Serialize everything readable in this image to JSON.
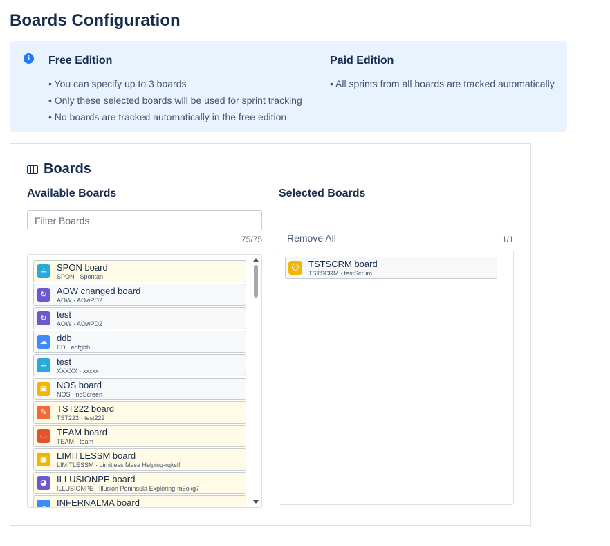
{
  "page": {
    "title": "Boards Configuration"
  },
  "info": {
    "free": {
      "title": "Free Edition",
      "items": [
        "• You can specify up to 3 boards",
        "• Only these selected boards will be used for sprint tracking",
        "• No boards are tracked automatically in the free edition"
      ]
    },
    "paid": {
      "title": "Paid Edition",
      "items": [
        "• All sprints from all boards are tracked automatically"
      ]
    }
  },
  "boards": {
    "title": "Boards",
    "available": {
      "title": "Available Boards",
      "filter_placeholder": "Filter Boards",
      "count": "75/75",
      "items": [
        {
          "name": "SPON board",
          "meta": "SPON · Spontan",
          "icon": "cup-icon",
          "color": "#2aa8d8",
          "glyph": "☕"
        },
        {
          "name": "AOW changed board",
          "meta": "AOW · AOwPD2",
          "icon": "refresh-icon",
          "color": "#6b5acd",
          "glyph": "↻"
        },
        {
          "name": "test",
          "meta": "AOW · AOwPD2",
          "icon": "refresh-icon",
          "color": "#6b5acd",
          "glyph": "↻"
        },
        {
          "name": "ddb",
          "meta": "ED · edfghb",
          "icon": "cloud-icon",
          "color": "#3d8bfd",
          "glyph": "☁"
        },
        {
          "name": "test",
          "meta": "XXXXX · xxxxx",
          "icon": "cup-icon",
          "color": "#2aa8d8",
          "glyph": "☕"
        },
        {
          "name": "NOS board",
          "meta": "NOS · noScreen",
          "icon": "wallet-icon",
          "color": "#f2b600",
          "glyph": "▣"
        },
        {
          "name": "TST222 board",
          "meta": "TST222 · test222",
          "icon": "wrench-icon",
          "color": "#f06a3b",
          "glyph": "✎"
        },
        {
          "name": "TEAM board",
          "meta": "TEAM · team",
          "icon": "window-icon",
          "color": "#e5532d",
          "glyph": "▭"
        },
        {
          "name": "LIMITLESSM board",
          "meta": "LIMITLESSM · Limitless Mesa Helping-rqkslf",
          "icon": "wallet-icon",
          "color": "#f2b600",
          "glyph": "▣"
        },
        {
          "name": "ILLUSIONPE board",
          "meta": "ILLUSIONPE · Illusion Peninsula Exploring-m5okg7",
          "icon": "bird-icon",
          "color": "#6b5acd",
          "glyph": "◕"
        },
        {
          "name": "INFERNALMA board",
          "meta": "",
          "icon": "cloud-icon",
          "color": "#3d8bfd",
          "glyph": "☁"
        }
      ]
    },
    "selected": {
      "title": "Selected Boards",
      "remove_all_label": "Remove All",
      "count": "1/1",
      "items": [
        {
          "name": "TSTSCRM board",
          "meta": "TSTSCRM · testScrum",
          "icon": "robot-icon",
          "color": "#f2b600",
          "glyph": "☺"
        }
      ]
    }
  }
}
